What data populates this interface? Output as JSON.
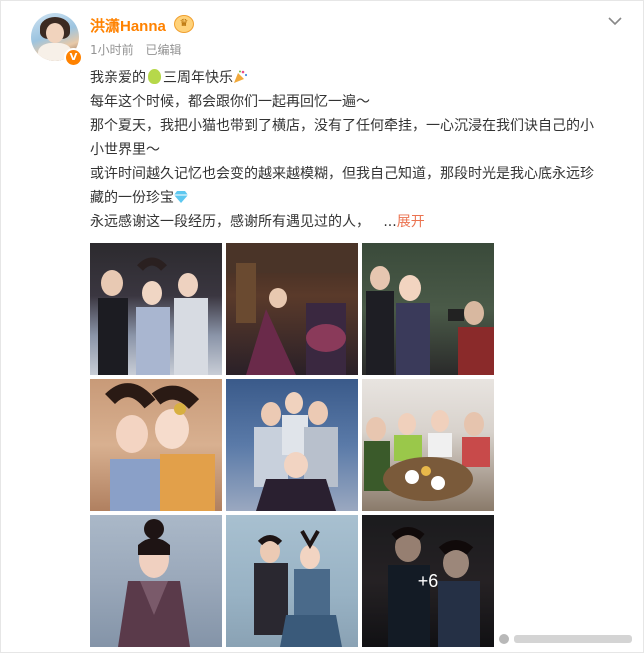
{
  "post": {
    "username": "洪潇Hanna",
    "time": "1小时前",
    "edited": "已编辑",
    "lines": [
      {
        "before": "我亲爱的",
        "after": "三周年快乐"
      },
      {
        "text": "每年这个时候，都会跟你们一起再回忆一遍～"
      },
      {
        "text": "那个夏天，我把小猫也带到了横店，没有了任何牵挂，一心沉浸在我们诀自己的小"
      },
      {
        "text": "小世界里～"
      },
      {
        "text": "或许时间越久记忆也会变的越来越模糊，但我自己知道，那段时光是我心底永远珍"
      },
      {
        "before": "藏的一份珍宝"
      },
      {
        "before": "永远感谢这一段经历，感谢所有遇见过的人，",
        "ellipsis": "...",
        "expand": "展开"
      }
    ],
    "more_count": "+6"
  },
  "icons": {
    "verified": "v-badge-icon",
    "member": "crown-icon",
    "menu": "chevron-down-icon",
    "emoji1": "pear-icon",
    "emoji2": "party-popper-icon",
    "emoji3": "gem-icon"
  },
  "colors": {
    "accent": "#ff8200",
    "link": "#eb7350",
    "text": "#333333",
    "meta": "#939393"
  }
}
